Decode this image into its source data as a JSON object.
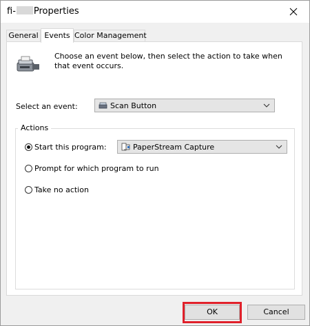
{
  "window": {
    "title_prefix": "fi-",
    "title_suffix": "Properties"
  },
  "tabs": [
    {
      "label": "General",
      "active": false
    },
    {
      "label": "Events",
      "active": true
    },
    {
      "label": "Color Management",
      "active": false
    }
  ],
  "events_tab": {
    "description": "Choose an event below, then select the action to take when that event occurs.",
    "select_event_label": "Select an event:",
    "event_selected": "Scan Button",
    "actions_label": "Actions",
    "options": [
      {
        "label": "Start this program:",
        "selected": true
      },
      {
        "label": "Prompt for which program to run",
        "selected": false
      },
      {
        "label": "Take no action",
        "selected": false
      }
    ],
    "program_selected": "PaperStream Capture"
  },
  "buttons": {
    "ok": "OK",
    "cancel": "Cancel"
  },
  "colors": {
    "highlight": "#e0202a"
  }
}
